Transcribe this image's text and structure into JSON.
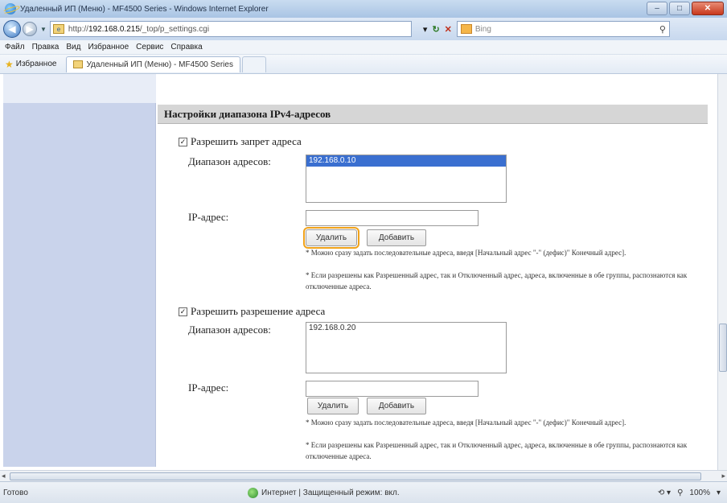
{
  "window": {
    "title": "Удаленный ИП (Меню) - MF4500 Series - Windows Internet Explorer",
    "controls": {
      "minimize": "–",
      "maximize": "□",
      "close": "✕"
    }
  },
  "address_bar": {
    "url_prefix": "http://",
    "url_host": "192.168.0.215",
    "url_path": "/_top/p_settings.cgi",
    "search_placeholder": "Bing"
  },
  "menu": [
    "Файл",
    "Правка",
    "Вид",
    "Избранное",
    "Сервис",
    "Справка"
  ],
  "favorites_bar": {
    "label": "Избранное",
    "tab_title": "Удаленный ИП (Меню) - MF4500 Series"
  },
  "page": {
    "section_title": "Настройки диапазона IPv4-адресов",
    "block1": {
      "checkbox_label": "Разрешить запрет адреса",
      "checked": true,
      "range_label": "Диапазон адресов:",
      "range_items": [
        "192.168.0.10"
      ],
      "ip_label": "IP-адрес:",
      "ip_value": "",
      "delete_button": "Удалить",
      "add_button": "Добавить",
      "note1": "* Можно сразу задать последовательные адреса, введя [Начальный адрес \"-\" (дефис)\" Конечный адрес].",
      "note2": "* Если разрешены как Разрешенный адрес, так и Отключенный адрес, адреса, включенные в обе группы, распознаются как отключенные адреса."
    },
    "block2": {
      "checkbox_label": "Разрешить разрешение адреса",
      "checked": true,
      "range_label": "Диапазон адресов:",
      "range_items": [
        "192.168.0.20"
      ],
      "ip_label": "IP-адрес:",
      "ip_value": "",
      "delete_button": "Удалить",
      "add_button": "Добавить",
      "note1": "* Можно сразу задать последовательные адреса, введя [Начальный адрес \"-\" (дефис)\" Конечный адрес].",
      "note2": "* Если разрешены как Разрешенный адрес, так и Отключенный адрес, адреса, включенные в обе группы, распознаются как отключенные адреса."
    }
  },
  "status_bar": {
    "left": "Готово",
    "zone": "Интернет | Защищенный режим: вкл.",
    "zoom": "100%"
  }
}
